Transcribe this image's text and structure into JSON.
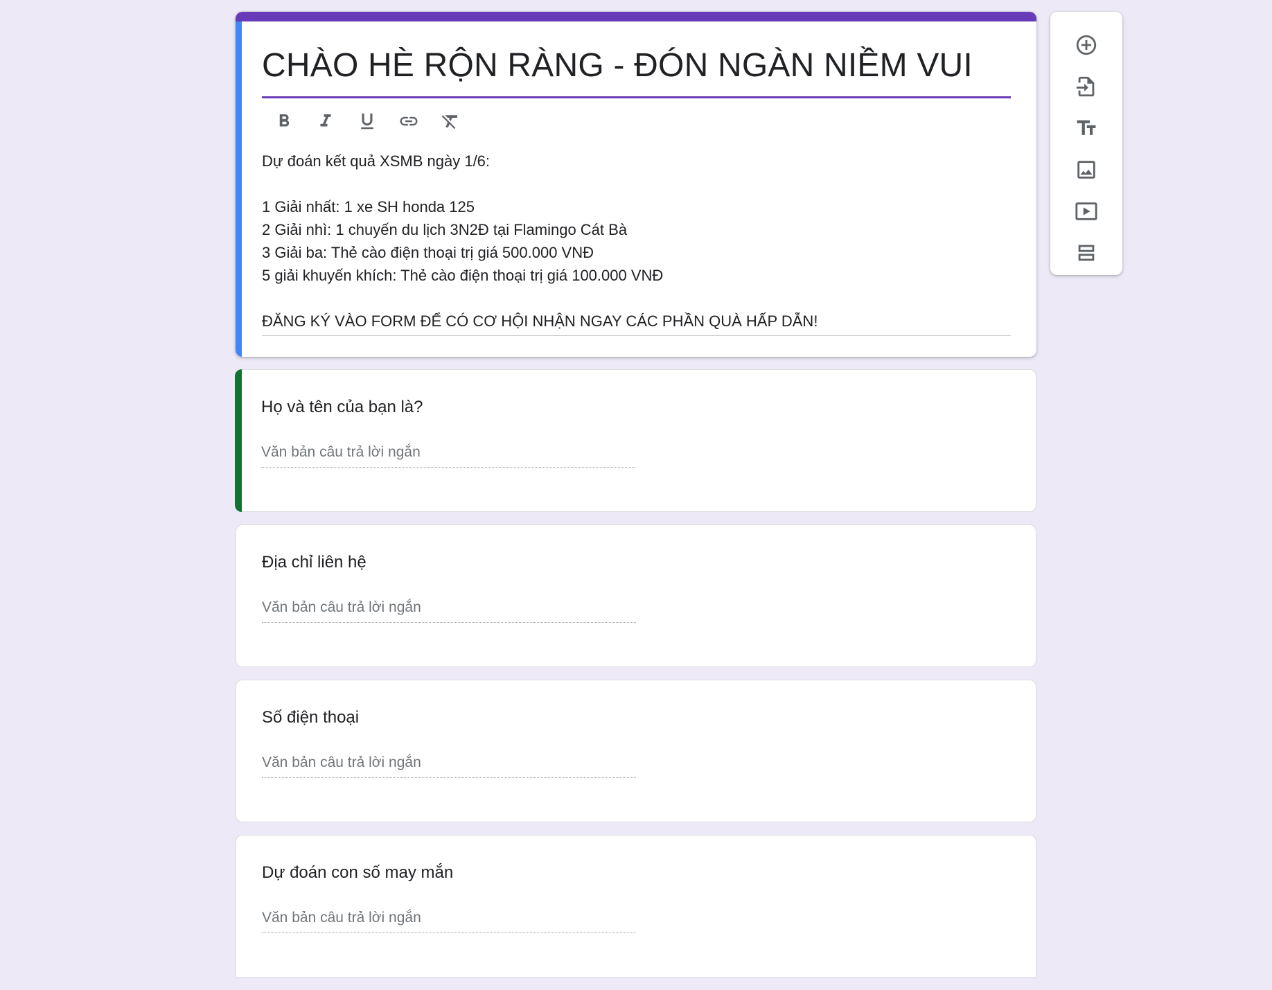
{
  "form": {
    "title": "CHÀO HÈ RỘN RÀNG - ĐÓN NGÀN NIỀM VUI",
    "description_lines": [
      "Dự đoán kết quả XSMB ngày 1/6:",
      "",
      "1 Giải nhất: 1 xe SH honda 125",
      "2 Giải nhì: 1 chuyến du lịch 3N2Đ tại Flamingo Cát Bà",
      "3 Giải ba: Thẻ cào điện thoại trị giá 500.000 VNĐ",
      "5 giải khuyến khích: Thẻ cào điện thoại trị giá 100.000 VNĐ",
      "",
      "ĐĂNG KÝ VÀO FORM ĐỂ CÓ CƠ HỘI NHẬN NGAY CÁC PHẦN QUÀ HẤP DẪN!"
    ]
  },
  "format_toolbar": {
    "items": [
      "bold-icon",
      "italic-icon",
      "underline-icon",
      "link-icon",
      "clear-format-icon"
    ]
  },
  "questions": [
    {
      "title": "Họ và tên của bạn là?",
      "answer_placeholder": "Văn bản câu trả lời ngắn"
    },
    {
      "title": "Địa chỉ liên hệ",
      "answer_placeholder": "Văn bản câu trả lời ngắn"
    },
    {
      "title": "Số điện thoại",
      "answer_placeholder": "Văn bản câu trả lời ngắn"
    },
    {
      "title": "Dự đoán con số may mắn",
      "answer_placeholder": "Văn bản câu trả lời ngắn"
    }
  ],
  "side_toolbar": {
    "items": [
      "add-question-icon",
      "import-questions-icon",
      "add-title-icon",
      "add-image-icon",
      "add-video-icon",
      "add-section-icon"
    ]
  },
  "colors": {
    "theme": "#673ab7",
    "header_accent": "#4285f4",
    "active_question": "#137333",
    "background": "#ede9f7"
  }
}
